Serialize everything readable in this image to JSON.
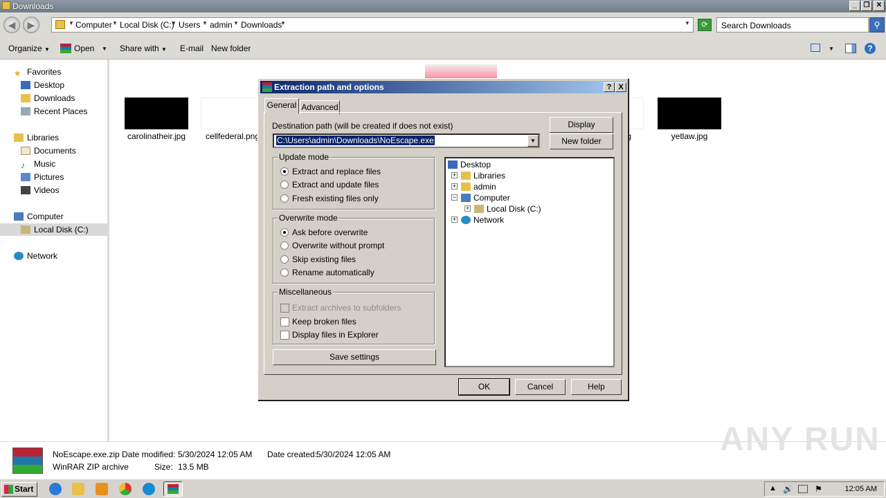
{
  "window": {
    "title": "Downloads"
  },
  "address": {
    "crumbs": [
      "Computer",
      "Local Disk (C:)",
      "Users",
      "admin",
      "Downloads"
    ],
    "search_placeholder": "Search Downloads"
  },
  "toolbar": {
    "organize": "Organize",
    "open": "Open",
    "share": "Share with",
    "email": "E-mail",
    "new_folder": "New folder"
  },
  "sidebar": {
    "favorites": "Favorites",
    "desktop": "Desktop",
    "downloads": "Downloads",
    "recent": "Recent Places",
    "libraries": "Libraries",
    "documents": "Documents",
    "music": "Music",
    "pictures": "Pictures",
    "videos": "Videos",
    "computer": "Computer",
    "local_disk": "Local Disk (C:)",
    "network": "Network"
  },
  "files": {
    "f1": "carolinatheir.jpg",
    "f2": "cellfederal.png",
    "f3": "png",
    "f4": "yetlaw.jpg"
  },
  "details": {
    "name": "NoEscape.exe.zip",
    "type": "WinRAR ZIP archive",
    "modified_label": "Date modified:",
    "modified": "5/30/2024 12:05 AM",
    "created_label": "Date created:",
    "created": "5/30/2024 12:05 AM",
    "size_label": "Size:",
    "size": "13.5 MB"
  },
  "dialog": {
    "title": "Extraction path and options",
    "help_btn": "?",
    "close_btn": "X",
    "tab_general": "General",
    "tab_advanced": "Advanced",
    "dest_label": "Destination path (will be created if does not exist)",
    "dest_value": "C:\\Users\\admin\\Downloads\\NoEscape.exe",
    "display_btn": "Display",
    "newfolder_btn": "New folder",
    "update_mode": {
      "title": "Update mode",
      "o1": "Extract and replace files",
      "o2": "Extract and update files",
      "o3": "Fresh existing files only"
    },
    "overwrite_mode": {
      "title": "Overwrite mode",
      "o1": "Ask before overwrite",
      "o2": "Overwrite without prompt",
      "o3": "Skip existing files",
      "o4": "Rename automatically"
    },
    "misc": {
      "title": "Miscellaneous",
      "c1": "Extract archives to subfolders",
      "c2": "Keep broken files",
      "c3": "Display files in Explorer"
    },
    "save_btn": "Save settings",
    "tree": {
      "desktop": "Desktop",
      "libraries": "Libraries",
      "admin": "admin",
      "computer": "Computer",
      "local_disk": "Local Disk (C:)",
      "network": "Network"
    },
    "ok": "OK",
    "cancel": "Cancel",
    "help": "Help"
  },
  "taskbar": {
    "start": "Start",
    "clock": "12:05 AM"
  },
  "watermark": "ANY RUN",
  "colors": {
    "dialog_title_start": "#0a246a",
    "dialog_title_end": "#a6caf0",
    "selection": "#0a246a"
  }
}
